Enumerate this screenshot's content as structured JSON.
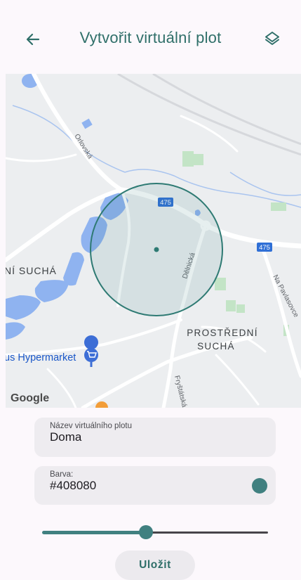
{
  "header": {
    "title": "Vytvořit virtuální plot",
    "back_icon": "arrow-left-icon",
    "layers_icon": "layers-icon"
  },
  "map": {
    "labels": {
      "orlovska": "Orlovská",
      "road_475_a": "475",
      "road_475_b": "475",
      "delnicka": "Dělnická",
      "na_pavlasovce": "Na Pavlasovce",
      "nisucha": "NÍ SUCHÁ",
      "prostredni_line1": "PROSTŘEDNÍ",
      "prostredni_line2": "SUCHÁ",
      "hypermarket": "us Hypermarket",
      "frystatska": "Fryštátská",
      "google": "Google"
    },
    "fence_color": "#408080"
  },
  "form": {
    "name_label": "Název virtuálního plotu",
    "name_value": "Doma",
    "color_label": "Barva:",
    "color_value": "#408080",
    "radius_fraction": 0.46
  },
  "actions": {
    "save_label": "Uložit"
  },
  "colors": {
    "accent": "#408080",
    "title": "#2f6f69",
    "background": "#fcf8fc"
  }
}
